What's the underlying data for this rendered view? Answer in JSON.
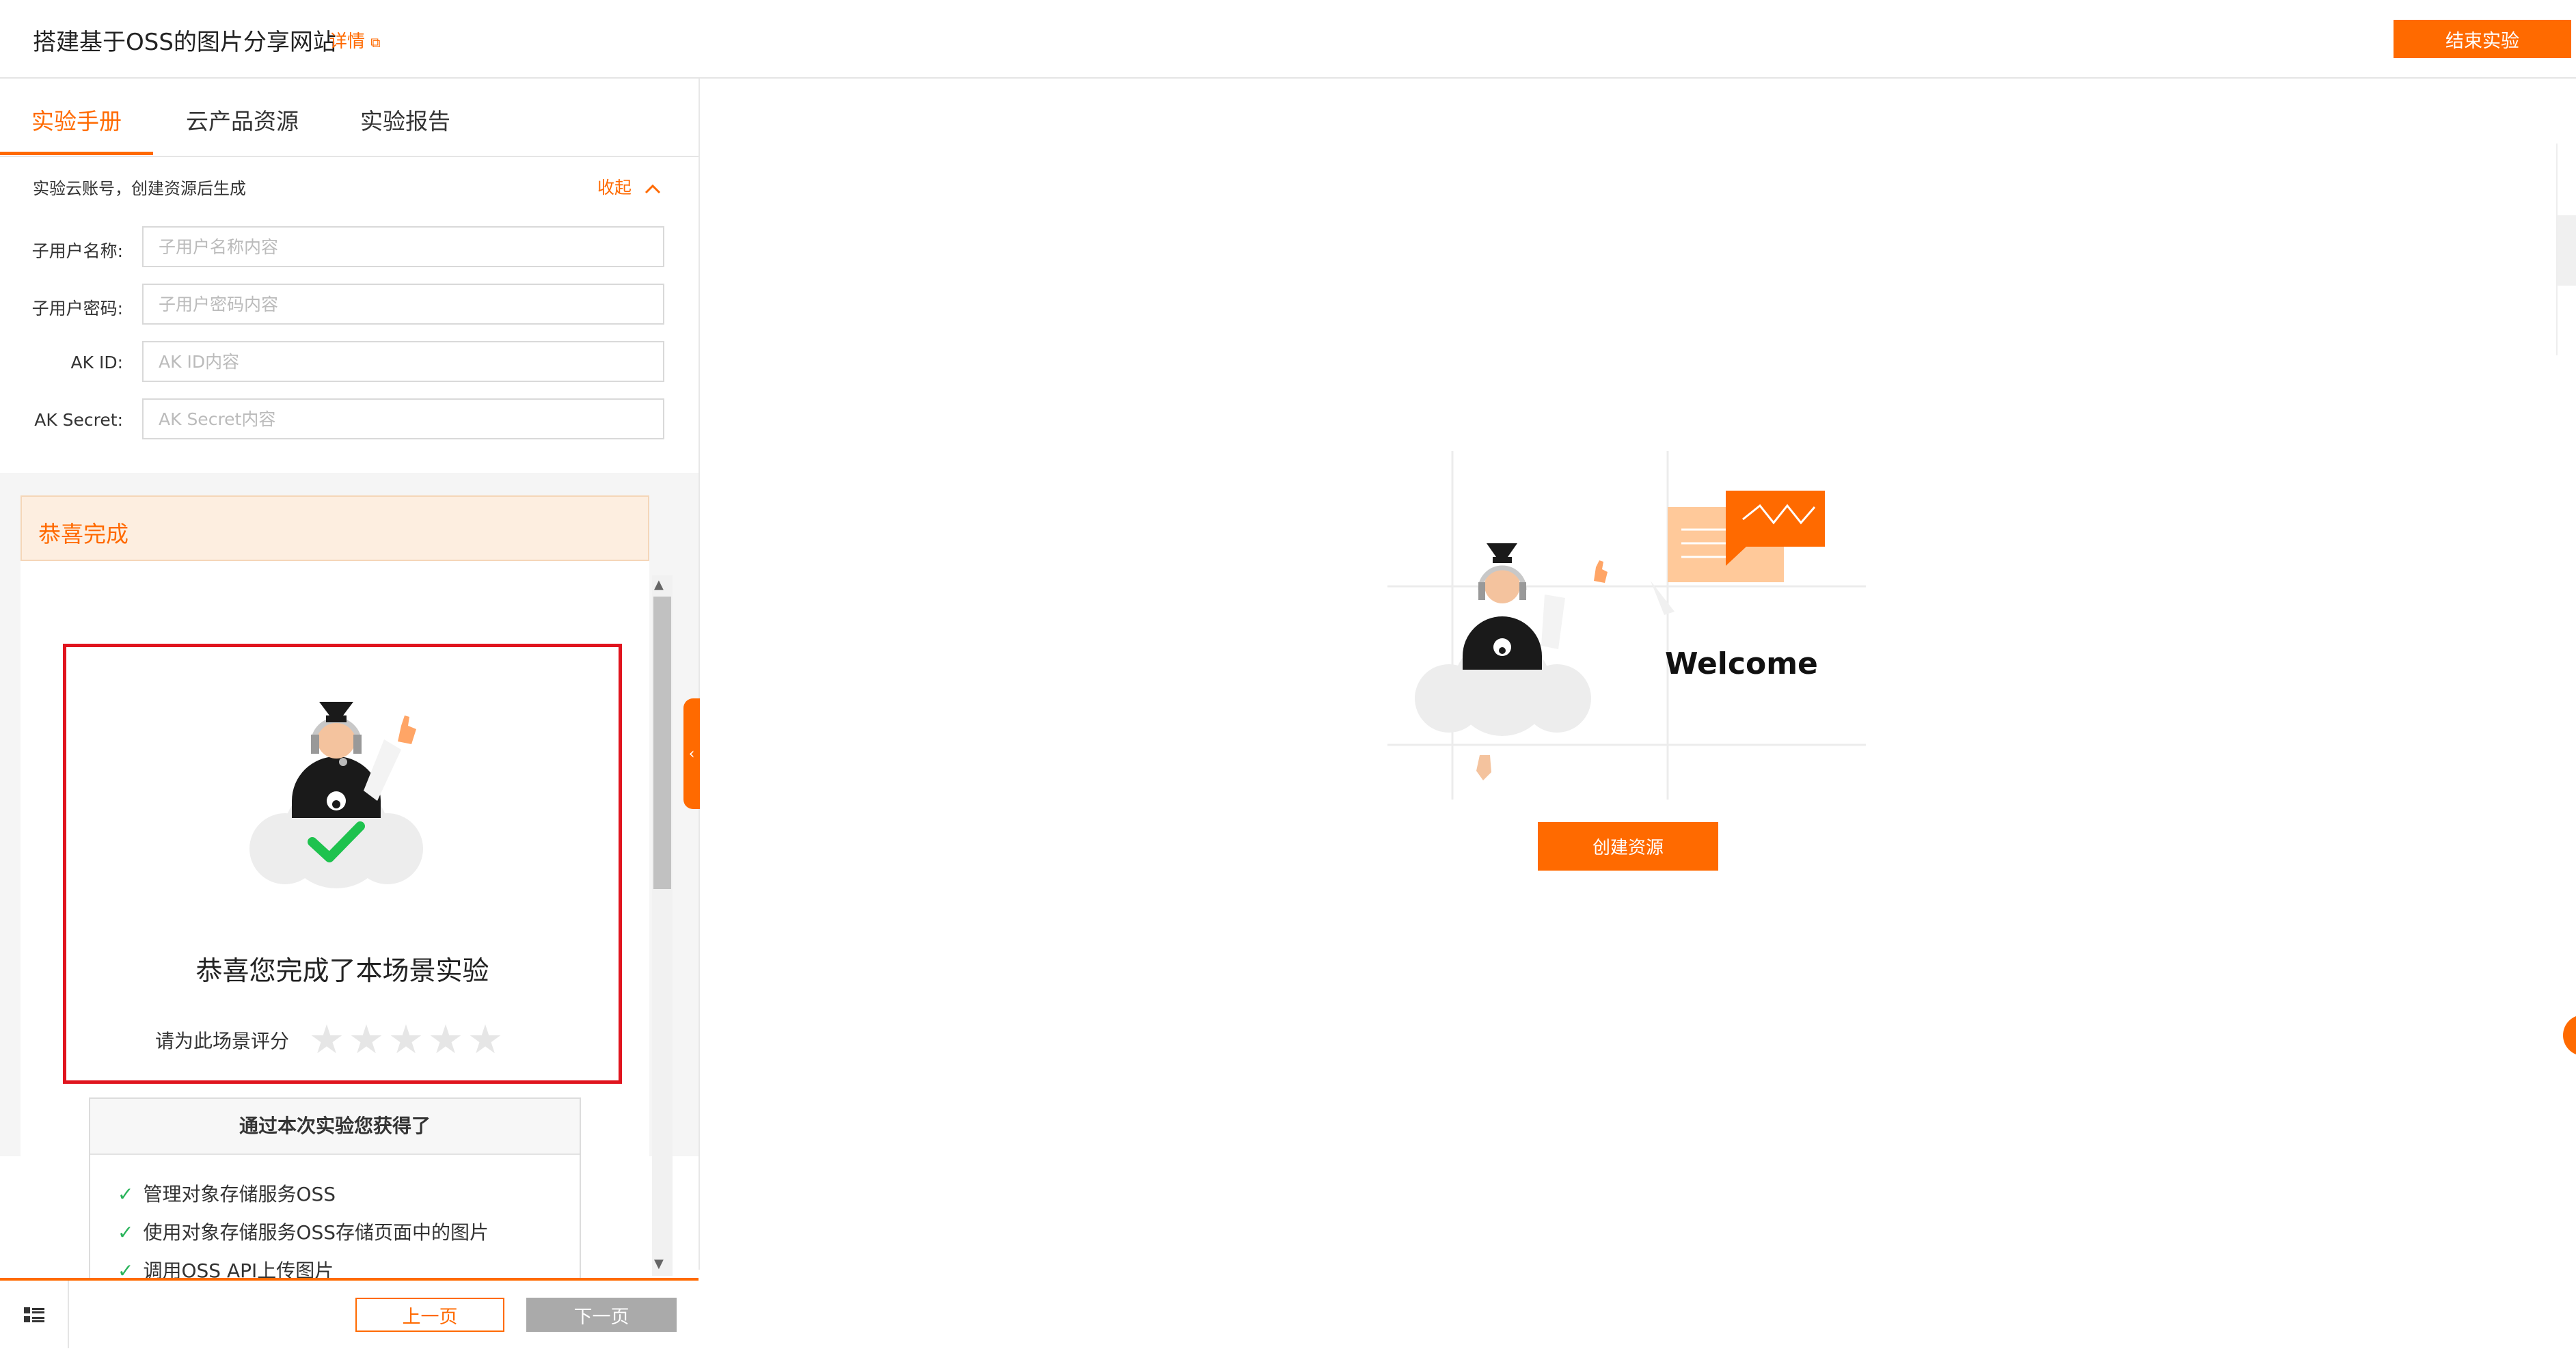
{
  "header": {
    "title": "搭建基于OSS的图片分享网站",
    "detail_link": "详情",
    "end_button": "结束实验"
  },
  "tabs": {
    "manual": "实验手册",
    "resources": "云产品资源",
    "report": "实验报告"
  },
  "account": {
    "note": "实验云账号，创建资源后生成",
    "collapse": "收起",
    "fields": [
      {
        "label": "子用户名称:",
        "placeholder": "子用户名称内容"
      },
      {
        "label": "子用户密码:",
        "placeholder": "子用户密码内容"
      },
      {
        "label": "AK ID:",
        "placeholder": "AK ID内容"
      },
      {
        "label": "AK Secret:",
        "placeholder": "AK Secret内容"
      }
    ]
  },
  "completion": {
    "header": "恭喜完成",
    "title": "恭喜您完成了本场景实验",
    "rate_label": "请为此场景评分",
    "rating": 0,
    "rating_max": 5,
    "gains_title": "通过本次实验您获得了",
    "gains": [
      "管理对象存储服务OSS",
      "使用对象存储服务OSS存储页面中的图片",
      "调用OSS API上传图片"
    ]
  },
  "footer": {
    "prev": "上一页",
    "next": "下一页"
  },
  "welcome": {
    "text": "Welcome",
    "create_button": "创建资源"
  },
  "colors": {
    "accent": "#ff6a00",
    "highlight_border": "#e0141e",
    "check_green": "#29b35a"
  }
}
